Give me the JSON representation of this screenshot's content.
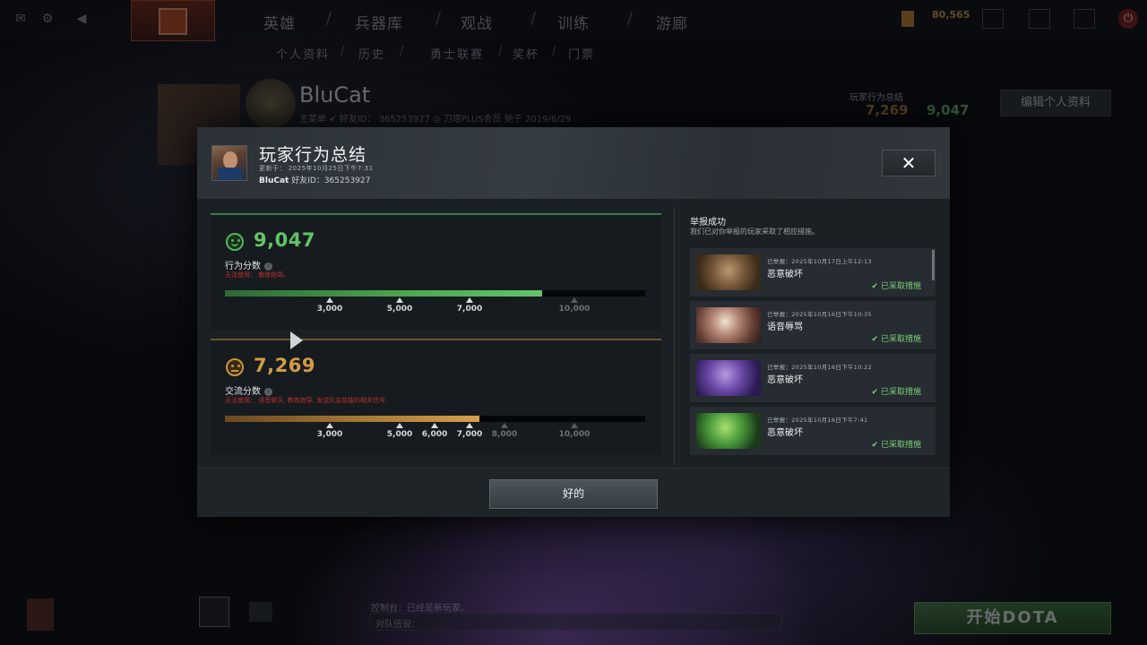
{
  "topbar": {
    "nav": [
      "英雄",
      "兵器库",
      "观战",
      "训练",
      "游廊"
    ],
    "currency": "80,565"
  },
  "subnav": [
    "个人资料",
    "历史",
    "勇士联赛",
    "奖杯",
    "门票"
  ],
  "profile": {
    "name": "BluCat",
    "meta": "主菜单   ✔ 好友ID： 365253927   ◎ 刀塔PLUS会员   始于 2019/6/29",
    "summary_label": "玩家行为总结",
    "comm_score": "7,269",
    "behavior_score": "9,047",
    "edit_button": "编辑个人资料"
  },
  "modal": {
    "title": "玩家行为总结",
    "updated": "更新于： 2025年10月25日下午7:31",
    "user_name": "BluCat",
    "user_id_label": "好友ID：",
    "user_id": "365253927",
    "close_label": "✕",
    "ok_label": "好的"
  },
  "behavior": {
    "value": "9,047",
    "label": "行为分数",
    "note_prefix": "无法使用：",
    "note_text": "教练指导。",
    "fill_fraction": 0.754,
    "ticks": [
      {
        "label": "3,000",
        "active": true
      },
      {
        "label": "5,000",
        "active": true
      },
      {
        "label": "7,000",
        "active": true
      },
      {
        "label": "10,000",
        "active": false
      }
    ]
  },
  "communication": {
    "value": "7,269",
    "label": "交流分数",
    "note_prefix": "无法使用：",
    "note_text": "语音聊天, 教练指导, 发送队友技能的相关信号.",
    "fill_fraction": 0.605,
    "ticks": [
      {
        "label": "3,000",
        "active": true
      },
      {
        "label": "5,000",
        "active": true
      },
      {
        "label": "6,000",
        "active": true
      },
      {
        "label": "7,000",
        "active": true
      },
      {
        "label": "8,000",
        "active": false
      },
      {
        "label": "10,000",
        "active": false
      }
    ]
  },
  "reports": {
    "title": "举报成功",
    "subtitle": "我们已对你举报的玩家采取了相应措施。",
    "items": [
      {
        "date": "已举报：2025年10月17日上午12:13",
        "reason": "恶意破坏",
        "status": "已采取措施"
      },
      {
        "date": "已举报：2025年10月16日下午10:35",
        "reason": "语音辱骂",
        "status": "已采取措施"
      },
      {
        "date": "已举报：2025年10月16日下午10:22",
        "reason": "恶意破坏",
        "status": "已采取措施"
      },
      {
        "date": "已举报：2025年10月16日下午7:41",
        "reason": "恶意破坏",
        "status": "已采取措施"
      }
    ]
  },
  "bottombar": {
    "status": "控制台：已经是新玩家。",
    "chat_placeholder": "对队伍说：",
    "start_button": "开始DOTA"
  },
  "colors": {
    "behavior_green": "#62c466",
    "comm_orange": "#d39b47",
    "warning_red": "#b8312a",
    "action_taken_green": "#7ed07a"
  }
}
